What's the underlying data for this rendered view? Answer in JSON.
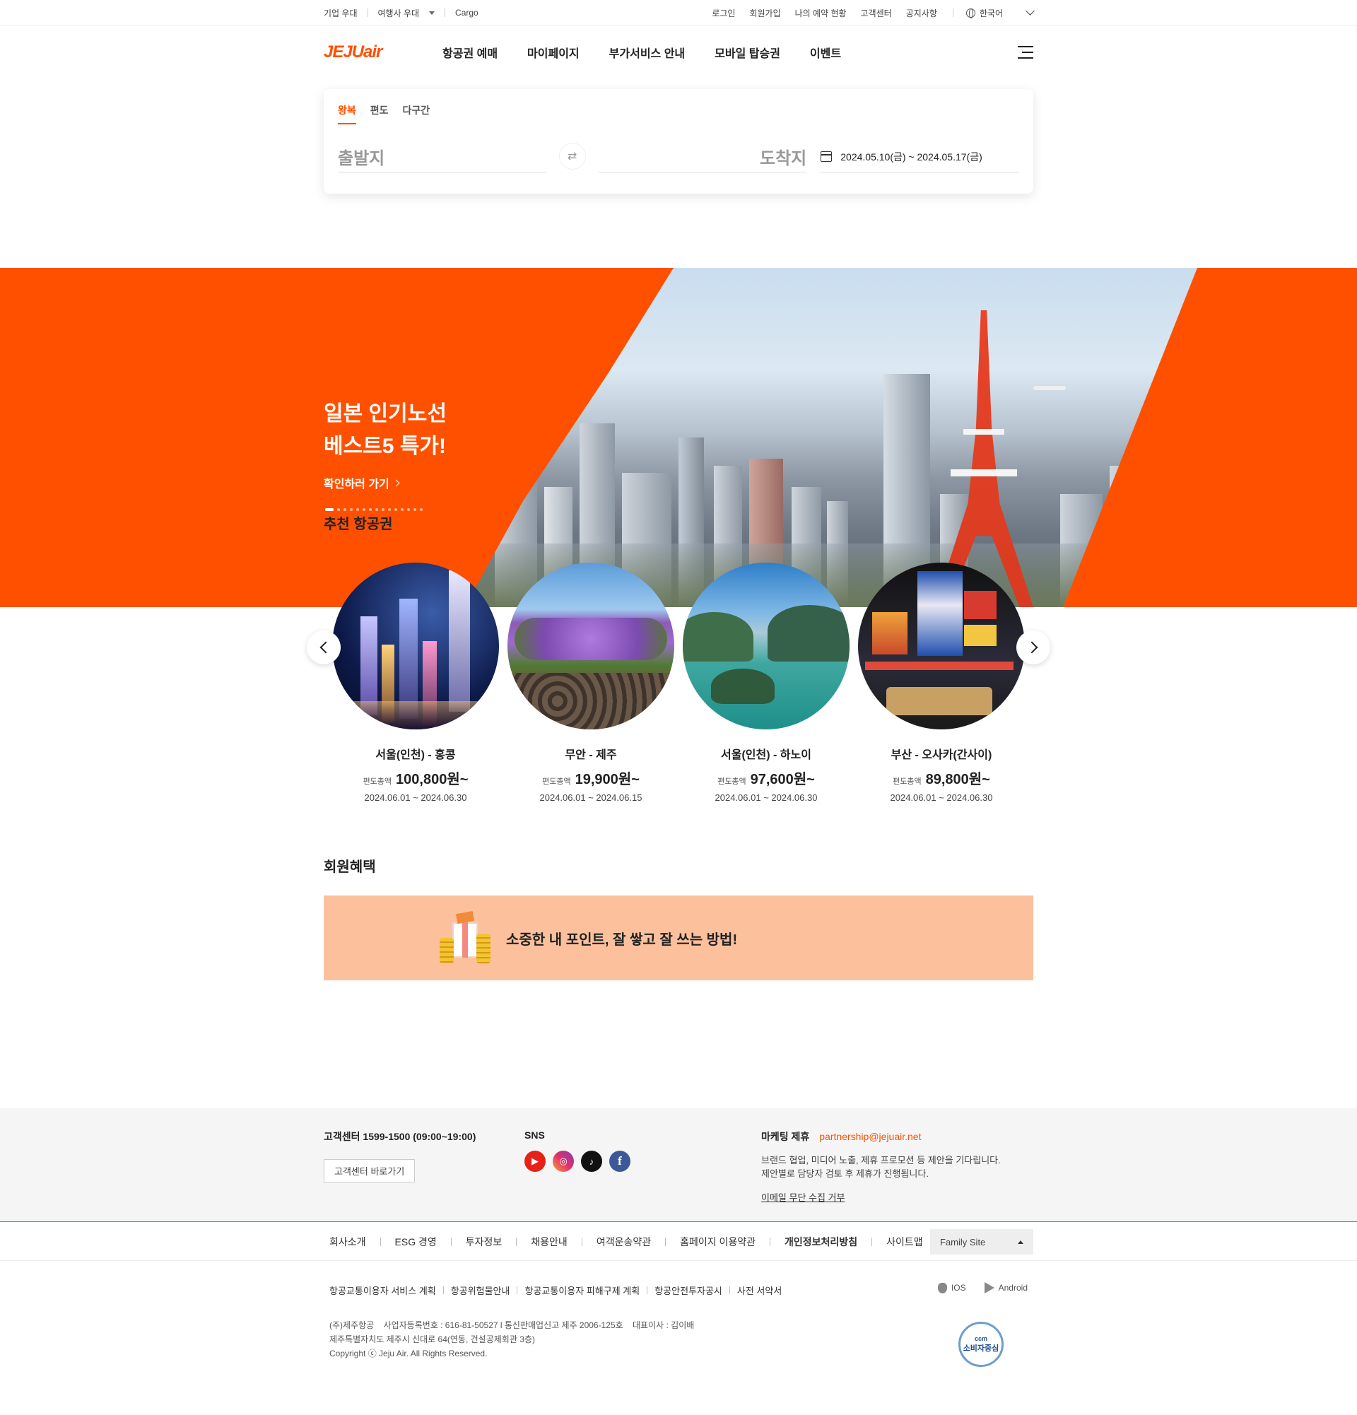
{
  "util": {
    "left": [
      "기업 우대",
      "여행사 우대",
      "Cargo"
    ],
    "right": [
      "로그인",
      "회원가입",
      "나의 예약 현황",
      "고객센터",
      "공지사항"
    ],
    "language": "한국어"
  },
  "gnb": {
    "logo": "JEJUair",
    "menu": [
      "항공권 예매",
      "마이페이지",
      "부가서비스 안내",
      "모바일 탑승권",
      "이벤트"
    ]
  },
  "booking": {
    "tabs": [
      "왕복",
      "편도",
      "다구간"
    ],
    "departure": "출발지",
    "arrival": "도착지",
    "dates": "2024.05.10(금) ~ 2024.05.17(금)"
  },
  "hero": {
    "title_line1": "일본 인기노선",
    "title_line2": "베스트5 특가!",
    "link": "확인하러 가기"
  },
  "recommend": {
    "title": "추천 항공권",
    "cards": [
      {
        "route": "서울(인천) - 홍콩",
        "label": "편도총액",
        "price": "100,800원~",
        "period": "2024.06.01 ~ 2024.06.30"
      },
      {
        "route": "무안 - 제주",
        "label": "편도총액",
        "price": "19,900원~",
        "period": "2024.06.01 ~ 2024.06.15"
      },
      {
        "route": "서울(인천) - 하노이",
        "label": "편도총액",
        "price": "97,600원~",
        "period": "2024.06.01 ~ 2024.06.30"
      },
      {
        "route": "부산 - 오사카(간사이)",
        "label": "편도총액",
        "price": "89,800원~",
        "period": "2024.06.01 ~ 2024.06.30"
      }
    ]
  },
  "member": {
    "title": "회원혜택",
    "banner": "소중한 내 포인트, 잘 쌓고 잘 쓰는 방법!"
  },
  "footer": {
    "cs": "고객센터 1599-1500 (09:00~19:00)",
    "cs_button": "고객센터 바로가기",
    "sns_title": "SNS",
    "marketing_title": "마케팅 제휴",
    "marketing_mail": "partnership@jejuair.net",
    "marketing_desc1": "브랜드 협업, 미디어 노출, 제휴 프로모션 등 제안을 기다립니다.",
    "marketing_desc2": "제안별로 담당자 검토 후 제휴가 진행됩니다.",
    "email_deny": "이메일 무단 수집 거부",
    "links": [
      "회사소개",
      "ESG 경영",
      "투자정보",
      "채용안내",
      "여객운송약관",
      "홈페이지 이용약관",
      "개인정보처리방침",
      "사이트맵"
    ],
    "family_site": "Family Site",
    "policies": [
      "항공교통이용자 서비스 계획",
      "항공위험물안내",
      "항공교통이용자 피해구제 계획",
      "항공안전투자공시",
      "사전 서약서"
    ],
    "info1": "(주)제주항공    사업자등록번호 : 616-81-50527 l 통신판매업신고 제주 2006-125호    대표이사 : 김이배",
    "info2": "제주특별자치도 제주시 신대로 64(연동, 건설공제회관 3층)",
    "copyright": "Copyright ⓒ Jeju Air. All Rights Reserved.",
    "ios": "IOS",
    "android": "Android",
    "ccm_top": "ccm",
    "ccm_main": "소비자중심"
  },
  "colors": {
    "brand": "#ff5000",
    "banner": "#fdc09d"
  }
}
